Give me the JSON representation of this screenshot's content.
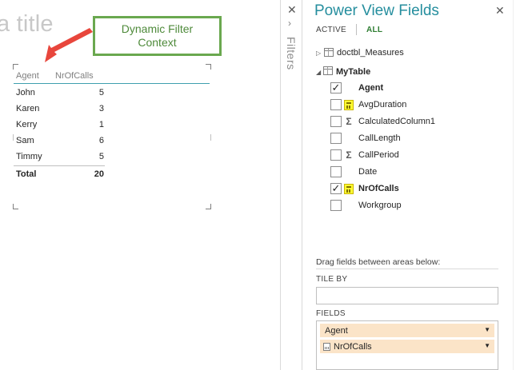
{
  "canvas": {
    "title_placeholder": "a title",
    "callout": {
      "line1": "Dynamic Filter",
      "line2": "Context"
    },
    "table": {
      "headers": {
        "agent": "Agent",
        "calls": "NrOfCalls"
      },
      "rows": [
        {
          "agent": "John",
          "calls": "5"
        },
        {
          "agent": "Karen",
          "calls": "3"
        },
        {
          "agent": "Kerry",
          "calls": "1"
        },
        {
          "agent": "Sam",
          "calls": "6"
        },
        {
          "agent": "Timmy",
          "calls": "5"
        }
      ],
      "total": {
        "label": "Total",
        "value": "20"
      }
    }
  },
  "filters_pane": {
    "close_icon": "close-icon",
    "label": "Filters"
  },
  "field_list": {
    "title": "Power View Fields",
    "tabs": {
      "active": "ACTIVE",
      "all": "ALL"
    },
    "tables": [
      {
        "name": "doctbl_Measures",
        "expanded": false
      },
      {
        "name": "MyTable",
        "expanded": true
      }
    ],
    "fields": [
      {
        "name": "Agent",
        "checked": true,
        "icon": "none",
        "bold": true
      },
      {
        "name": "AvgDuration",
        "checked": false,
        "icon": "calculator",
        "bold": false
      },
      {
        "name": "CalculatedColumn1",
        "checked": false,
        "icon": "sigma",
        "bold": false
      },
      {
        "name": "CallLength",
        "checked": false,
        "icon": "none",
        "bold": false
      },
      {
        "name": "CallPeriod",
        "checked": false,
        "icon": "sigma",
        "bold": false
      },
      {
        "name": "Date",
        "checked": false,
        "icon": "none",
        "bold": false
      },
      {
        "name": "NrOfCalls",
        "checked": true,
        "icon": "calculator",
        "bold": true
      },
      {
        "name": "Workgroup",
        "checked": false,
        "icon": "none",
        "bold": false
      }
    ],
    "drag_hint": "Drag fields between areas below:",
    "areas": {
      "tile_by_label": "TILE BY",
      "fields_label": "FIELDS",
      "fields_items": [
        {
          "name": "Agent",
          "icon": "none"
        },
        {
          "name": "NrOfCalls",
          "icon": "calculator"
        }
      ]
    }
  }
}
